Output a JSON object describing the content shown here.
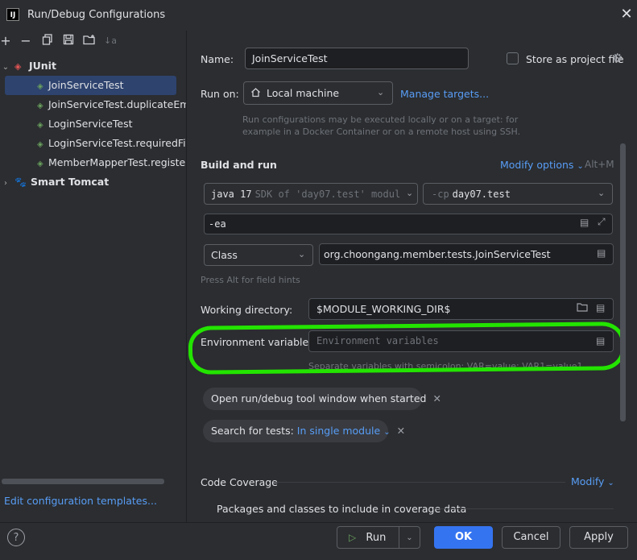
{
  "window": {
    "title": "Run/Debug Configurations",
    "app_logo": "IJ",
    "close_icon": "✕"
  },
  "left_toolbar": {
    "add": "+",
    "remove": "−",
    "copy": "⧉",
    "save": "💾",
    "folder": "📁",
    "sort": "↓a"
  },
  "tree": {
    "junit_group": "JUnit",
    "items": [
      "JoinServiceTest",
      "JoinServiceTest.duplicateEmailTest",
      "LoginServiceTest",
      "LoginServiceTest.requiredFieldTest",
      "MemberMapperTest.registerTest"
    ],
    "tomcat_group": "Smart Tomcat"
  },
  "edit_templates_link": "Edit configuration templates...",
  "form": {
    "name_label": "Name:",
    "name_value": "JoinServiceTest",
    "store_label": "Store as project file",
    "store_checked": false,
    "run_on_label": "Run on:",
    "run_on_value": "Local machine",
    "manage_targets": "Manage targets...",
    "run_on_hint_1": "Run configurations may be executed locally or on a target: for",
    "run_on_hint_2": "example in a Docker Container or on a remote host using SSH.",
    "build_run_title": "Build and run",
    "modify_options": "Modify options",
    "modify_shortcut": "Alt+M",
    "jdk_version": "java 17",
    "jdk_detail": "SDK of 'day07.test' modul",
    "cp_flag": "-cp",
    "cp_value": "day07.test",
    "vm_options": "-ea",
    "test_kind": "Class",
    "class_value": "org.choongang.member.tests.JoinServiceTest",
    "field_hint": "Press Alt for field hints",
    "working_dir_label": "Working directory:",
    "working_dir_value": "$MODULE_WORKING_DIR$",
    "env_label": "Environment variables:",
    "env_placeholder": "Environment variables",
    "env_hint": "Separate variables with semicolon: VAR=value; VAR1=value1",
    "open_tool_window": "Open run/debug tool window when started",
    "search_tests_label": "Search for tests:",
    "search_tests_value": "In single module",
    "code_coverage": "Code Coverage",
    "coverage_modify": "Modify",
    "packages_label": "Packages and classes to include in coverage data"
  },
  "bottom": {
    "help": "?",
    "run": "Run",
    "ok": "OK",
    "cancel": "Cancel",
    "apply": "Apply"
  },
  "colors": {
    "accent": "#3574f0",
    "link": "#589df6",
    "highlight": "#23e400",
    "selection": "#2e436e"
  }
}
